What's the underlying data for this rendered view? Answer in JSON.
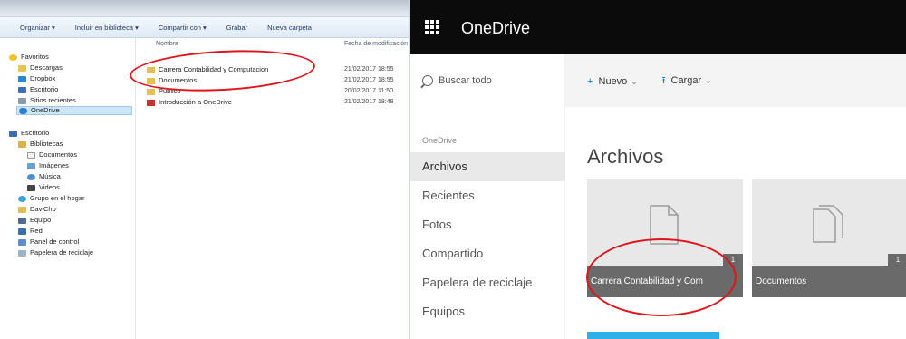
{
  "explorer": {
    "toolbar": [
      "Organizar ▾",
      "Incluir en biblioteca ▾",
      "Compartir con ▾",
      "Grabar",
      "Nueva carpeta"
    ],
    "column_headers": {
      "name": "Nombre",
      "date": "Fecha de modificación"
    },
    "nav": {
      "favorites": [
        {
          "label": "Favoritos"
        },
        {
          "label": "Descargas"
        },
        {
          "label": "Dropbox"
        },
        {
          "label": "Escritorio"
        },
        {
          "label": "Sitios recientes"
        },
        {
          "label": "OneDrive"
        }
      ],
      "tree": [
        {
          "label": "Escritorio"
        },
        {
          "label": "Bibliotecas"
        },
        {
          "label": "Documentos"
        },
        {
          "label": "Imágenes"
        },
        {
          "label": "Música"
        },
        {
          "label": "Videos"
        },
        {
          "label": "Grupo en el hogar"
        },
        {
          "label": "DaviCho"
        },
        {
          "label": "Equipo"
        },
        {
          "label": "Red"
        },
        {
          "label": "Panel de control"
        },
        {
          "label": "Papelera de reciclaje"
        }
      ]
    },
    "files": [
      {
        "name": "Carrera Contabilidad y Computacion",
        "date": "21/02/2017 18:55"
      },
      {
        "name": "Documentos",
        "date": "21/02/2017 18:55"
      },
      {
        "name": "Público",
        "date": "20/02/2017 11:50"
      },
      {
        "name": "Introducción a OneDrive",
        "date": "21/02/2017 18:48"
      }
    ]
  },
  "onedrive": {
    "brand": "OneDrive",
    "search_placeholder": "Buscar todo",
    "commands": {
      "new": "Nuevo",
      "upload": "Cargar"
    },
    "nav_group": "OneDrive",
    "nav_items": [
      "Archivos",
      "Recientes",
      "Fotos",
      "Compartido",
      "Papelera de reciclaje",
      "Equipos"
    ],
    "active_nav": "Archivos",
    "page_title": "Archivos",
    "tiles": [
      {
        "name": "Carrera Contabilidad y Com",
        "count": "1"
      },
      {
        "name": "Documentos",
        "count": "1"
      }
    ]
  },
  "colors": {
    "od_header": "#0b0b0b",
    "od_accent": "#0078d7",
    "annotation": "#e0151b",
    "tile_foot": "#6a6a6a"
  }
}
